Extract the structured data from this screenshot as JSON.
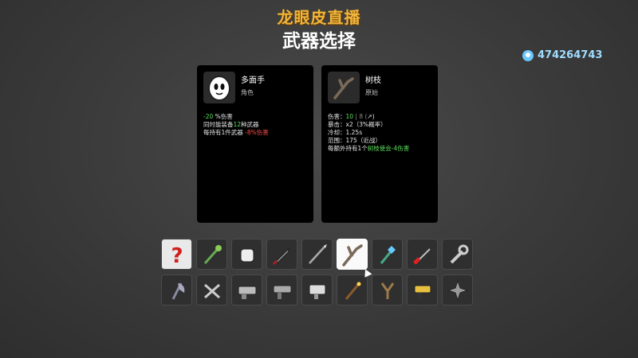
{
  "header": {
    "logo_text": "龙眼皮直播",
    "title": "武器选择"
  },
  "badge": {
    "id_text": "474264743"
  },
  "character": {
    "name": "多面手",
    "type": "角色",
    "lines": [
      {
        "parts": [
          {
            "t": "-20",
            "c": "g"
          },
          {
            "t": " %伤害",
            "c": ""
          }
        ]
      },
      {
        "parts": [
          {
            "t": "同时能装备",
            "c": ""
          },
          {
            "t": "12",
            "c": "g"
          },
          {
            "t": "种武器",
            "c": ""
          }
        ]
      },
      {
        "parts": [
          {
            "t": "每持有1件武器 ",
            "c": ""
          },
          {
            "t": "-8%伤害",
            "c": "r"
          }
        ]
      }
    ]
  },
  "weapon": {
    "name": "树枝",
    "type": "原始",
    "lines": [
      {
        "parts": [
          {
            "t": "伤害：",
            "c": ""
          },
          {
            "t": "10",
            "c": "g"
          },
          {
            "t": " | 8 (",
            "c": "gray"
          },
          {
            "t": "↗",
            "c": ""
          },
          {
            "t": ")",
            "c": ""
          }
        ]
      },
      {
        "parts": [
          {
            "t": "暴击：x2（3%概率）",
            "c": ""
          }
        ]
      },
      {
        "parts": [
          {
            "t": "冷却：1.25s",
            "c": ""
          }
        ]
      },
      {
        "parts": [
          {
            "t": "范围：175（近战）",
            "c": ""
          }
        ]
      },
      {
        "parts": [
          {
            "t": "每额外持有1个",
            "c": ""
          },
          {
            "t": "树枝",
            "c": "g"
          },
          {
            "t": "使会-4伤害",
            "c": "g"
          }
        ]
      }
    ]
  },
  "grid": {
    "row1": [
      "random",
      "spiked-mace",
      "fist",
      "knife",
      "spear",
      "stick",
      "crystal-staff",
      "screwdriver",
      "wrench"
    ],
    "row2": [
      "axe",
      "scissors",
      "minigun",
      "smg",
      "shredder",
      "wand",
      "slingshot",
      "taser",
      "shuriken"
    ],
    "selected": "stick"
  }
}
